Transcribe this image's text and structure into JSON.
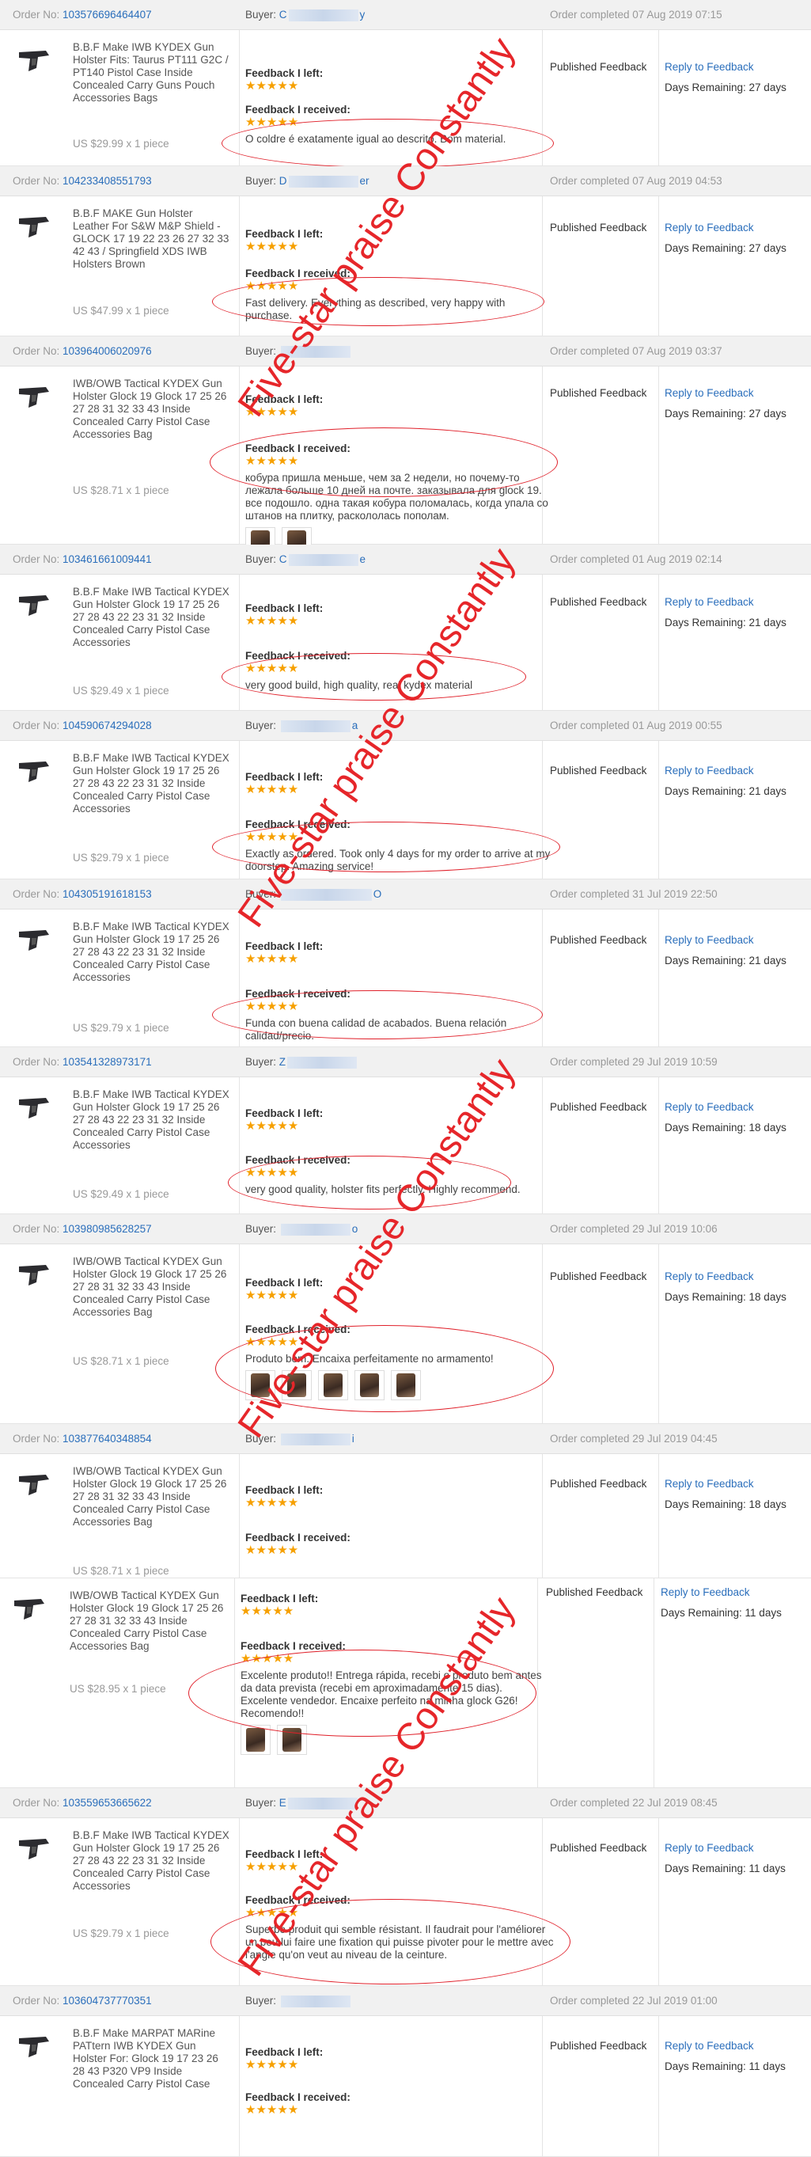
{
  "labels": {
    "order_no": "Order No: ",
    "buyer": "Buyer: ",
    "feedback_left": "Feedback I left:",
    "feedback_received": "Feedback I received:",
    "published": "Published Feedback",
    "reply": "Reply to Feedback",
    "stars": "★★★★★"
  },
  "watermark": "Five-star praise Constantly",
  "colors": {
    "link": "#2a6ebb",
    "star": "#f6a000",
    "annotation": "#e0202a"
  },
  "orders": [
    {
      "order_no": "103576696464407",
      "buyer_a": "C",
      "buyer_b": "y",
      "status": "Order completed 07 Aug 2019 07:15",
      "product": "B.B.F Make IWB KYDEX Gun Holster Fits: Taurus PT111 G2C / PT140 Pistol Case Inside Concealed Carry Guns Pouch Accessories Bags",
      "price": "US $29.99 x 1 piece",
      "received": "O coldre é exatamente igual ao descrito. Bom material.",
      "days": "Days Remaining: 27 days"
    },
    {
      "order_no": "104233408551793",
      "buyer_a": "D",
      "buyer_b": "er",
      "status": "Order completed 07 Aug 2019 04:53",
      "product": "B.B.F MAKE Gun Holster Leather For S&W M&P Shield - GLOCK 17 19 22 23 26 27 32 33 42 43 / Springfield XDS IWB Holsters Brown",
      "price": "US $47.99 x 1 piece",
      "received": "Fast delivery. Everything as described, very happy with purchase.",
      "days": "Days Remaining: 27 days"
    },
    {
      "order_no": "103964006020976",
      "buyer_a": "",
      "buyer_b": "",
      "status": "Order completed 07 Aug 2019 03:37",
      "product": "IWB/OWB Tactical KYDEX Gun Holster Glock 19 Glock 17 25 26 27 28 31 32 33 43 Inside Concealed Carry Pistol Case Accessories Bag",
      "price": "US $28.71 x 1 piece",
      "received": "кобура пришла меньше, чем за 2 недели, но почему-то лежала больше 10 дней на почте. заказывала для glock 19. все подошло. одна такая кобура поломалась, когда упала со штанов на плитку, раскололась пополам.",
      "days": "Days Remaining: 27 days"
    },
    {
      "order_no": "103461661009441",
      "buyer_a": "C",
      "buyer_b": "e",
      "status": "Order completed 01 Aug 2019 02:14",
      "product": "B.B.F Make IWB Tactical KYDEX Gun Holster Glock 19 17 25 26 27 28 43 22 23 31 32 Inside Concealed Carry Pistol Case Accessories",
      "price": "US $29.49 x 1 piece",
      "received": "very good build, high quality, real kydex material",
      "days": "Days Remaining: 21 days"
    },
    {
      "order_no": "104590674294028",
      "buyer_a": "",
      "buyer_b": "a",
      "status": "Order completed 01 Aug 2019 00:55",
      "product": "B.B.F Make IWB Tactical KYDEX Gun Holster Glock 19 17 25 26 27 28 43 22 23 31 32 Inside Concealed Carry Pistol Case Accessories",
      "price": "US $29.79 x 1 piece",
      "received": "Exactly as ordered. Took only 4 days for my order to arrive at my doorstep. Amazing service!",
      "days": "Days Remaining: 21 days"
    },
    {
      "order_no": "104305191618153",
      "buyer_a": "",
      "buyer_b": "O",
      "status": "Order completed 31 Jul 2019 22:50",
      "product": "B.B.F Make IWB Tactical KYDEX Gun Holster Glock 19 17 25 26 27 28 43 22 23 31 32 Inside Concealed Carry Pistol Case Accessories",
      "price": "US $29.79 x 1 piece",
      "received": "Funda con buena calidad de acabados. Buena relación calidad/precio.",
      "days": "Days Remaining: 21 days"
    },
    {
      "order_no": "103541328973171",
      "buyer_a": "Z",
      "buyer_b": "",
      "status": "Order completed 29 Jul 2019 10:59",
      "product": "B.B.F Make IWB Tactical KYDEX Gun Holster Glock 19 17 25 26 27 28 43 22 23 31 32 Inside Concealed Carry Pistol Case Accessories",
      "price": "US $29.49 x 1 piece",
      "received": "very good quality, holster fits perfectly. Highly recommend.",
      "days": "Days Remaining: 18 days"
    },
    {
      "order_no": "103980985628257",
      "buyer_a": "",
      "buyer_b": "o",
      "status": "Order completed 29 Jul 2019 10:06",
      "product": "IWB/OWB Tactical KYDEX Gun Holster Glock 19 Glock 17 25 26 27 28 31 32 33 43 Inside Concealed Carry Pistol Case Accessories Bag",
      "price": "US $28.71 x 1 piece",
      "received": "Produto bom. Encaixa perfeitamente no armamento!",
      "days": "Days Remaining: 18 days"
    },
    {
      "order_no": "103877640348854",
      "buyer_a": "",
      "buyer_b": "i",
      "status": "Order completed 29 Jul 2019 04:45",
      "product": "IWB/OWB Tactical KYDEX Gun Holster Glock 19 Glock 17 25 26 27 28 31 32 33 43 Inside Concealed Carry Pistol Case Accessories Bag",
      "price": "US $28.71 x 1 piece",
      "received": "",
      "days": "Days Remaining: 18 days"
    },
    {
      "order_no": "",
      "buyer_a": "",
      "buyer_b": "",
      "status": "",
      "product": "IWB/OWB Tactical KYDEX Gun Holster Glock 19 Glock 17 25 26 27 28 31 32 33 43 Inside Concealed Carry Pistol Case Accessories Bag",
      "price": "US $28.95 x 1 piece",
      "received": "Excelente produto!! Entrega rápida, recebi o produto bem antes da data prevista (recebi em aproximadamente 15 dias). Excelente vendedor. Encaixe perfeito na minha glock G26! Recomendo!!",
      "days": "Days Remaining: 11 days"
    },
    {
      "order_no": "103559653665622",
      "buyer_a": "E",
      "buyer_b": "",
      "status": "Order completed 22 Jul 2019 08:45",
      "product": "B.B.F Make IWB Tactical KYDEX Gun Holster Glock 19 17 25 26 27 28 43 22 23 31 32 Inside Concealed Carry Pistol Case Accessories",
      "price": "US $29.79 x 1 piece",
      "received": "Superbe produit qui semble résistant. Il faudrait pour l'améliorer un peu lui faire une fixation qui puisse pivoter pour le mettre avec l'angle qu'on veut au niveau de la ceinture.",
      "days": "Days Remaining: 11 days"
    },
    {
      "order_no": "103604737770351",
      "buyer_a": "",
      "buyer_b": "",
      "status": "Order completed 22 Jul 2019 01:00",
      "product": "B.B.F Make MARPAT MARine PATtern IWB KYDEX Gun Holster For: Glock 19 17 23 26 28 43 P320 VP9 Inside Concealed Carry Pistol Case",
      "price": "",
      "received": "",
      "days": "Days Remaining: 11 days"
    }
  ]
}
